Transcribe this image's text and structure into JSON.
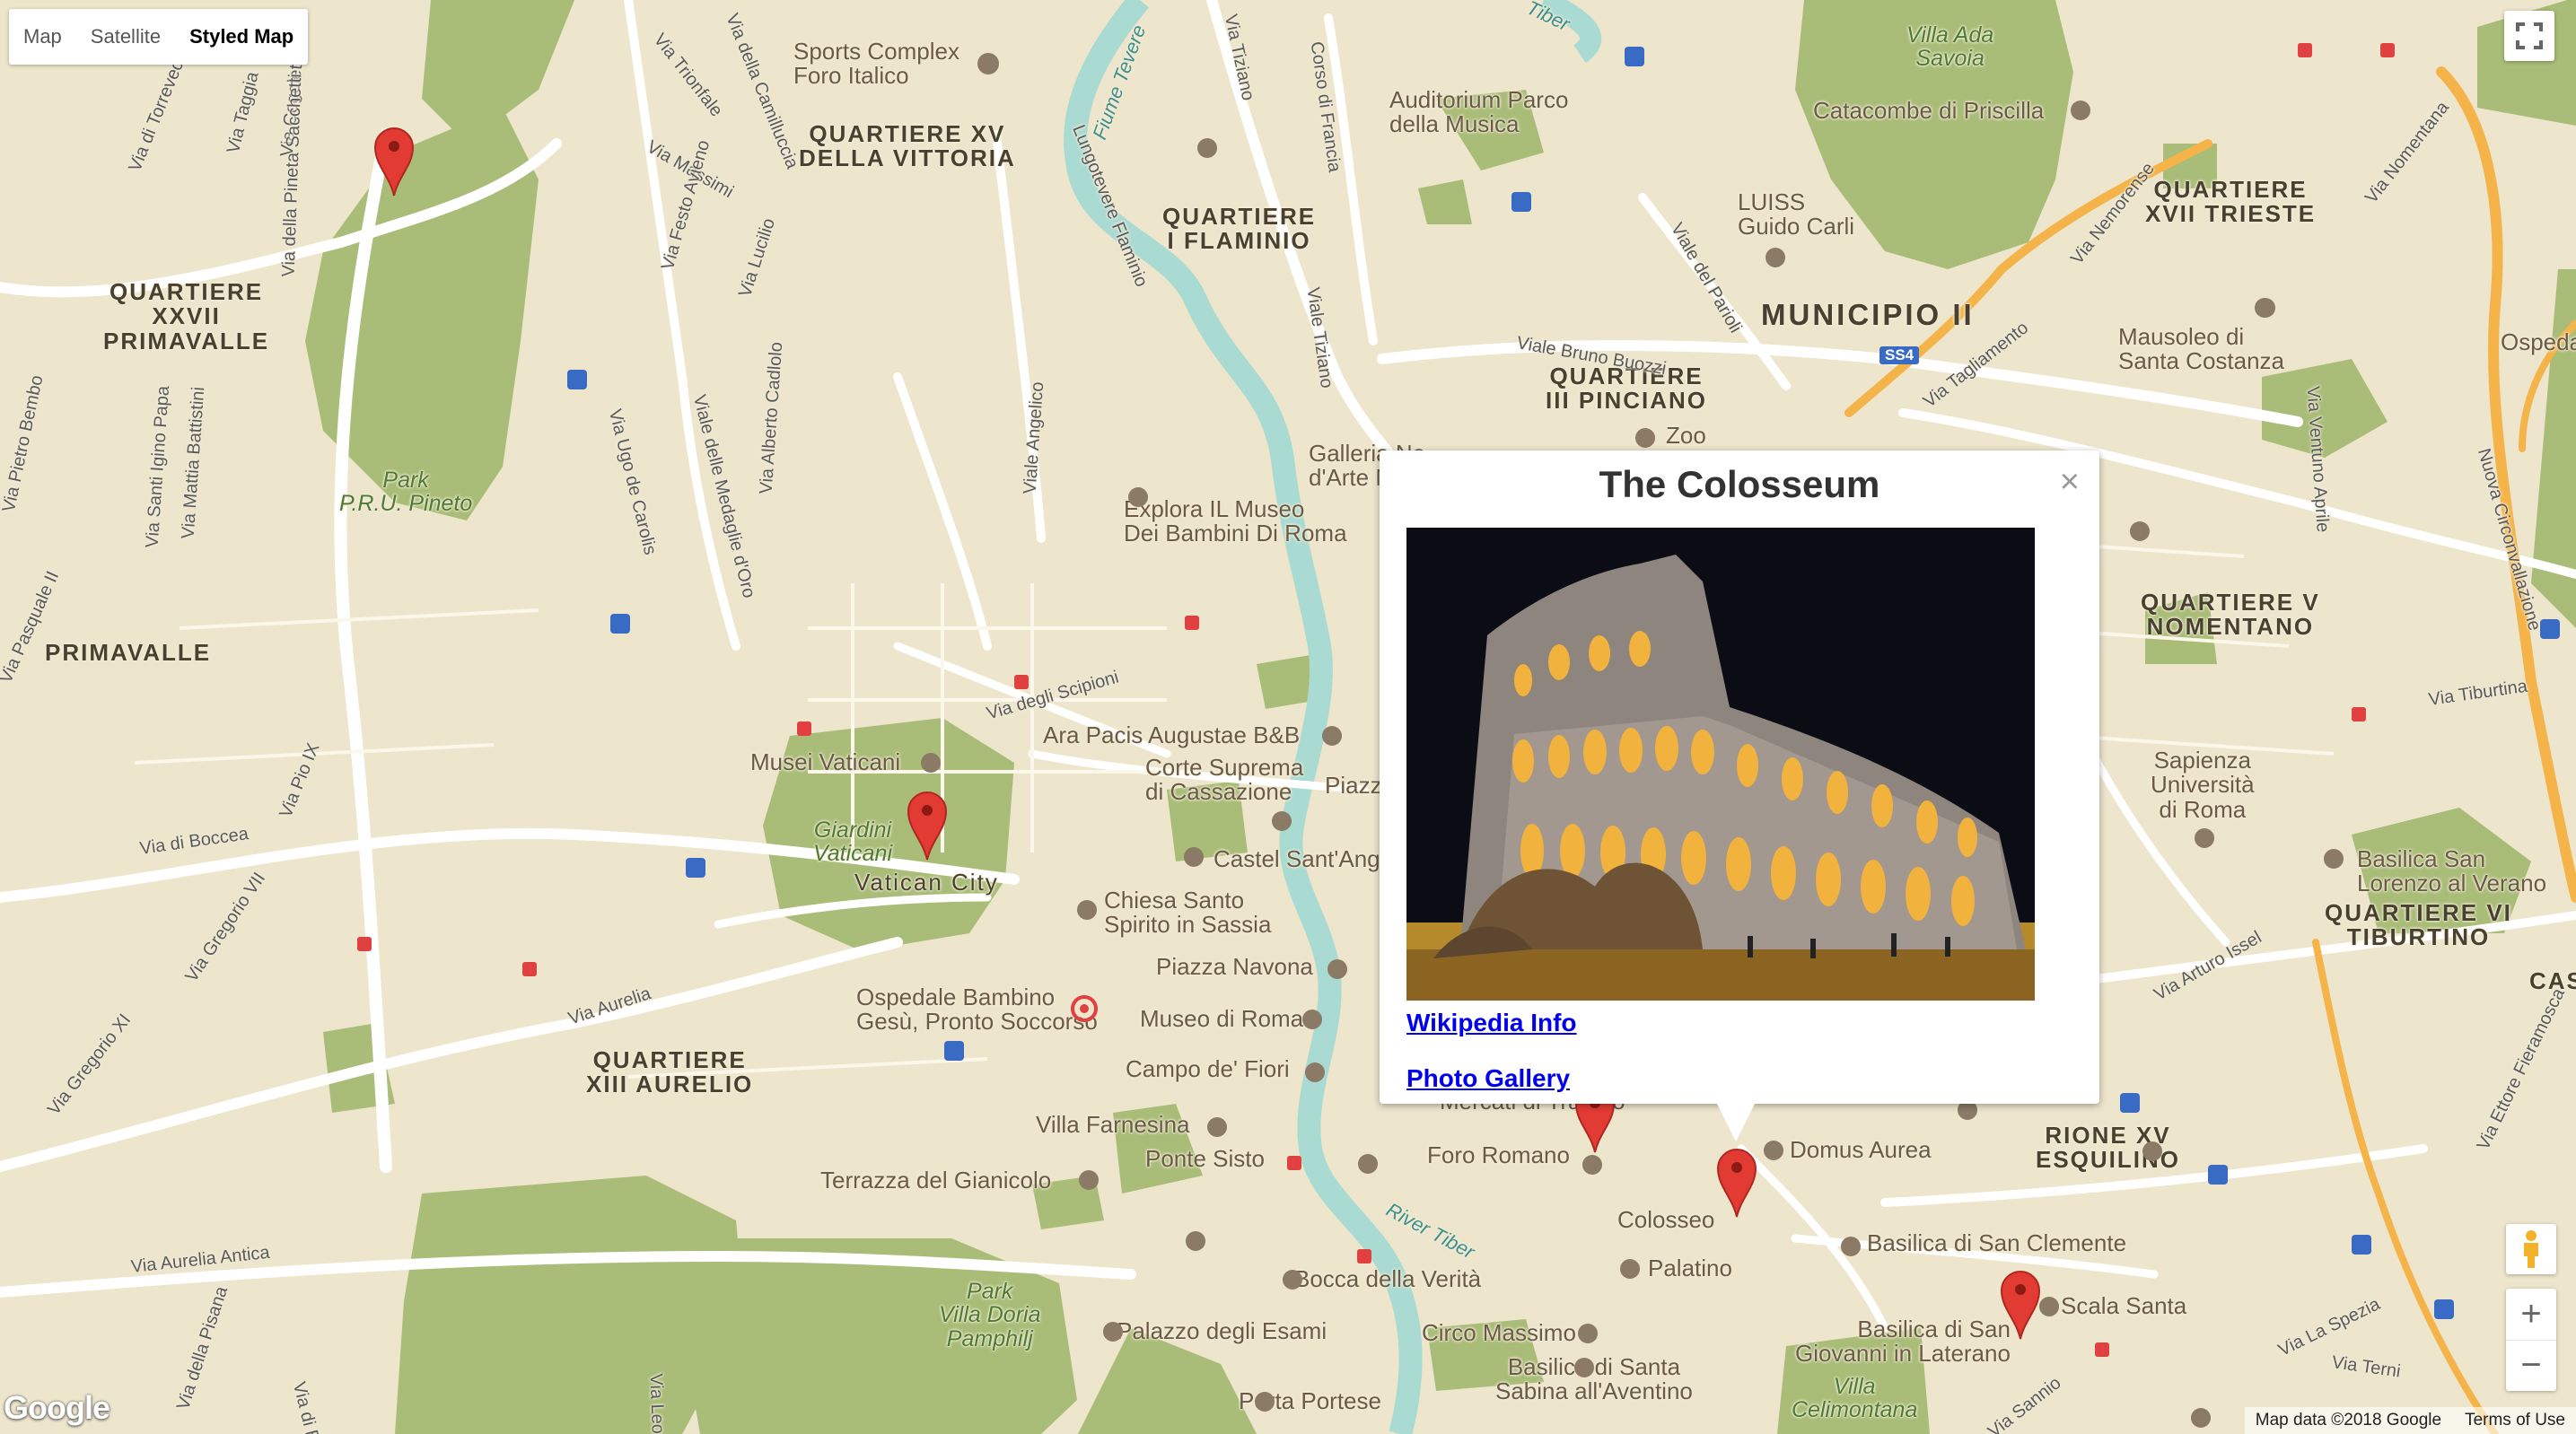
{
  "map_type": {
    "options": [
      "Map",
      "Satellite",
      "Styled Map"
    ],
    "active": "Styled Map"
  },
  "districts": [
    "QUARTIERE XV\nDELLA VITTORIA",
    "QUARTIERE\nI FLAMINIO",
    "QUARTIERE\nXXVII\nPRIMAVALLE",
    "PRIMAVALLE",
    "QUARTIERE\nXVII TRIESTE",
    "MUNICIPIO II",
    "QUARTIERE\nIII PINCIANO",
    "QUARTIERE V\nNOMENTANO",
    "QUARTIERE\nXIII AURELIO",
    "RIONE XV\nESQUILINO",
    "QUARTIERE VI\nTIBURTINO",
    "CASA"
  ],
  "places": [
    "Sports Complex\nForo Italico",
    "Auditorium Parco\ndella Musica",
    "Villa Ada\nSavoia",
    "Catacombe di Priscilla",
    "LUISS\nGuido Carli",
    "Mausoleo di\nSanta Costanza",
    "Ospedal",
    "Galleria Na\nd'Arte M",
    "Zoo",
    "Explora IL Museo\nDei Bambini Di Roma",
    "Ara Pacis Augustae B&B",
    "Musei Vaticani",
    "Corte Suprema\ndi Cassazione",
    "Piazz",
    "Castel Sant'Ang",
    "Vatican City",
    "Chiesa Santo\nSpirito in Sassia",
    "Piazza Navona",
    "Ospedale Bambino\nGesù, Pronto Soccorso",
    "Museo di Roma",
    "Campo de' Fiori",
    "Villa Farnesina",
    "Ponte Sisto",
    "Terrazza del Gianicolo",
    "Foro Romano",
    "Domus Aurea",
    "Colosseo",
    "Basilica di San Clemente",
    "Palatino",
    "Bocca della Verità",
    "Scala Santa",
    "Basilica di San\nGiovanni in Laterano",
    "Palazzo degli Esami",
    "Circo Massimo",
    "Basilica di Santa\nSabina all'Aventino",
    "Porta Portese",
    "Sapienza\nUniversità\ndi Roma",
    "Basilica San\nLorenzo al Verano",
    "Mercati di Traiano"
  ],
  "parks": [
    "Park\nP.R.U. Pineto",
    "Giardini\nVaticani",
    "Park\nVilla Doria\nPamphilj",
    "Villa\nCelimontana"
  ],
  "water": [
    "Fiume Tevere",
    "River Tiber",
    "Tiber"
  ],
  "streets": [
    "Via Trionfale",
    "Via della Camilluccia",
    "Via di Torrevecchia",
    "Via Taggia",
    "Via Cogoleto",
    "Via Massimi",
    "Via Festo Avieno",
    "Via Lucilio",
    "Via Tiziano",
    "Corso di Francia",
    "Lungotevere Flaminio",
    "Viale del Parioli",
    "Viale Bruno Buozzi",
    "Via Nemorense",
    "Via Nomentana",
    "Viale Tiziano",
    "Via Tagliamento",
    "Via della Pineta Sacchetti",
    "Via Mattia Battistini",
    "Via Pietro Bembo",
    "Via Santi Igino Papa",
    "Via Ugo de Carolis",
    "Viale delle Medaglie d'Oro",
    "Via Alberto Cadlolo",
    "Viale Angelico",
    "Via degli Scipioni",
    "Via Pasquale II",
    "Via di Boccea",
    "Via Gregorio VII",
    "Via Aurelia",
    "Via Pio IX",
    "Via Gregorio XI",
    "Via Aurelia Antica",
    "Via Leone XIII",
    "Via della Pisana",
    "Via di Bravetta",
    "Via Tiburtina",
    "Via Ventuno Aprile",
    "Nuova Circonvallazione",
    "Via Ettore Fieramosca",
    "Via La Spezia",
    "Via Terni",
    "Via Sannio",
    "Via Arturo Issel"
  ],
  "road_shield": "SS4",
  "markers": [
    "Monte Mario marker",
    "Vatican City marker",
    "Mercati di Traiano marker",
    "Colosseo marker",
    "San Giovanni marker"
  ],
  "infowindow": {
    "title": "The Colosseum",
    "close": "×",
    "photo_alt": "Colosseum at night",
    "links": [
      "Wikipedia Info",
      "Photo Gallery"
    ]
  },
  "controls": {
    "zoom_in": "+",
    "zoom_out": "−",
    "fullscreen": "fullscreen",
    "pegman": "Street View"
  },
  "footer": {
    "copyright": "Map data ©2018 Google",
    "terms": "Terms of Use"
  },
  "logo": "Google",
  "colors": {
    "land": "#ede5cc",
    "park": "#a9bd78",
    "water": "#aadbd2",
    "road": "#ffffff",
    "highway": "#f5b44a",
    "marker": "#e23b33"
  }
}
